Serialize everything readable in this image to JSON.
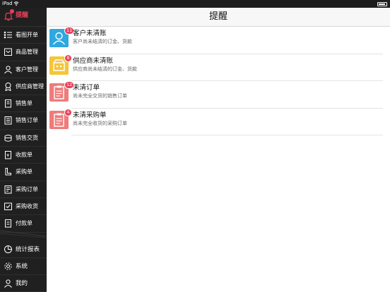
{
  "status_bar": {
    "carrier": "iPad"
  },
  "sidebar": {
    "header_label": "提醒",
    "items": [
      {
        "label": "看图开单",
        "icon": "menu-list-icon"
      },
      {
        "label": "商品管理",
        "icon": "box-icon"
      },
      {
        "label": "客户管理",
        "icon": "users-icon"
      },
      {
        "label": "供应商管理",
        "icon": "supplier-icon"
      },
      {
        "label": "销售单",
        "icon": "document-icon"
      },
      {
        "label": "销售订单",
        "icon": "order-icon"
      },
      {
        "label": "销售交货",
        "icon": "delivery-icon"
      },
      {
        "label": "收款单",
        "icon": "receipt-icon"
      },
      {
        "label": "采购单",
        "icon": "purchase-icon"
      },
      {
        "label": "采购订单",
        "icon": "purchase-order-icon"
      },
      {
        "label": "采购收货",
        "icon": "receive-icon"
      },
      {
        "label": "付款单",
        "icon": "payment-icon"
      }
    ],
    "bottom_items": [
      {
        "label": "统计报表",
        "icon": "pie-chart-icon"
      },
      {
        "label": "系统",
        "icon": "gear-icon"
      },
      {
        "label": "我的",
        "icon": "user-icon"
      }
    ]
  },
  "navbar": {
    "title": "提醒"
  },
  "reminders": [
    {
      "title": "客户未清账",
      "subtitle": "客户尚未结清的订金、货款",
      "badge": "11",
      "color": "#2fa8e0",
      "icon": "customer-icon"
    },
    {
      "title": "供应商未清账",
      "subtitle": "供应商尚未结清的订金、货款",
      "badge": "8",
      "color": "#f5c53a",
      "icon": "supplier-icon"
    },
    {
      "title": "未清订单",
      "subtitle": "尚未完全交货的销售订单",
      "badge": "12",
      "color": "#ee7c7a",
      "icon": "clipboard-icon"
    },
    {
      "title": "未清采购单",
      "subtitle": "尚未完全收货的采购订单",
      "badge": "4",
      "color": "#ee7c7a",
      "icon": "clipboard-icon"
    }
  ]
}
